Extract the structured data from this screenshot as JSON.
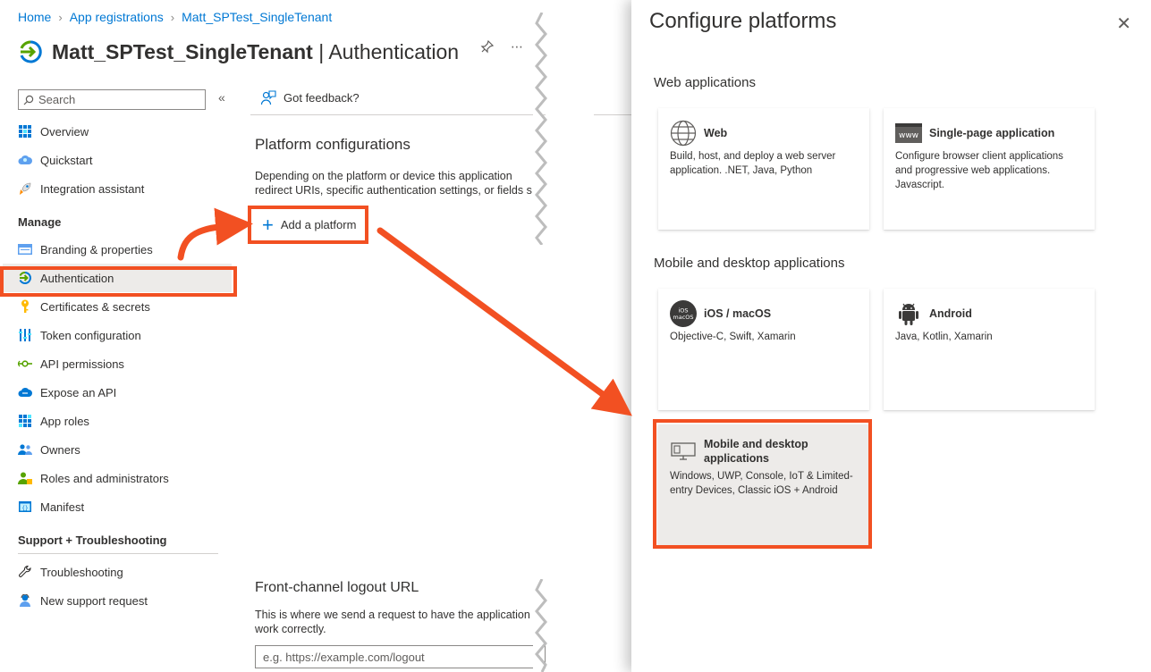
{
  "breadcrumb": {
    "items": [
      "Home",
      "App registrations",
      "Matt_SPTest_SingleTenant"
    ]
  },
  "header": {
    "app_name": "Matt_SPTest_SingleTenant",
    "separator": " | ",
    "section": "Authentication"
  },
  "search": {
    "placeholder": "Search"
  },
  "nav": {
    "top_items": [
      {
        "label": "Overview",
        "icon": "grid-icon"
      },
      {
        "label": "Quickstart",
        "icon": "cloud-icon"
      },
      {
        "label": "Integration assistant",
        "icon": "rocket-icon"
      }
    ],
    "manage_label": "Manage",
    "manage_items": [
      {
        "label": "Branding & properties",
        "icon": "branding-icon"
      },
      {
        "label": "Authentication",
        "icon": "authentication-icon",
        "active": true
      },
      {
        "label": "Certificates & secrets",
        "icon": "key-icon"
      },
      {
        "label": "Token configuration",
        "icon": "token-icon"
      },
      {
        "label": "API permissions",
        "icon": "api-permissions-icon"
      },
      {
        "label": "Expose an API",
        "icon": "cloud-api-icon"
      },
      {
        "label": "App roles",
        "icon": "app-roles-icon"
      },
      {
        "label": "Owners",
        "icon": "owners-icon"
      },
      {
        "label": "Roles and administrators",
        "icon": "roles-icon"
      },
      {
        "label": "Manifest",
        "icon": "manifest-icon"
      }
    ],
    "support_label": "Support + Troubleshooting",
    "support_items": [
      {
        "label": "Troubleshooting",
        "icon": "wrench-icon"
      },
      {
        "label": "New support request",
        "icon": "support-person-icon"
      }
    ]
  },
  "main": {
    "feedback_label": "Got feedback?",
    "platform_heading": "Platform configurations",
    "platform_desc_line1": "Depending on the platform or device this application",
    "platform_desc_line2": "redirect URIs, specific authentication settings, or fields s",
    "add_platform_label": "Add a platform",
    "logout_heading": "Front-channel logout URL",
    "logout_desc_line1": "This is where we send a request to have the application",
    "logout_desc_line2": "work correctly.",
    "logout_placeholder": "e.g. https://example.com/logout"
  },
  "panel": {
    "title": "Configure platforms",
    "web_group": "Web applications",
    "mobile_group": "Mobile and desktop applications",
    "cards": {
      "web": {
        "name": "Web",
        "desc": "Build, host, and deploy a web server application. .NET, Java, Python"
      },
      "spa": {
        "name": "Single-page application",
        "desc": "Configure browser client applications and progressive web applications. Javascript.",
        "icon_text": "www"
      },
      "ios": {
        "name": "iOS / macOS",
        "desc": "Objective-C, Swift, Xamarin",
        "icon_text_1": "iOS",
        "icon_text_2": "macOS"
      },
      "android": {
        "name": "Android",
        "desc": "Java, Kotlin, Xamarin"
      },
      "desktop": {
        "name_line1": "Mobile and desktop",
        "name_line2": "applications",
        "desc": "Windows, UWP, Console, IoT & Limited-entry Devices, Classic iOS + Android"
      }
    }
  },
  "colors": {
    "accent": "#0078d4",
    "highlight": "#f25022",
    "selected_bg": "#edebe9"
  }
}
